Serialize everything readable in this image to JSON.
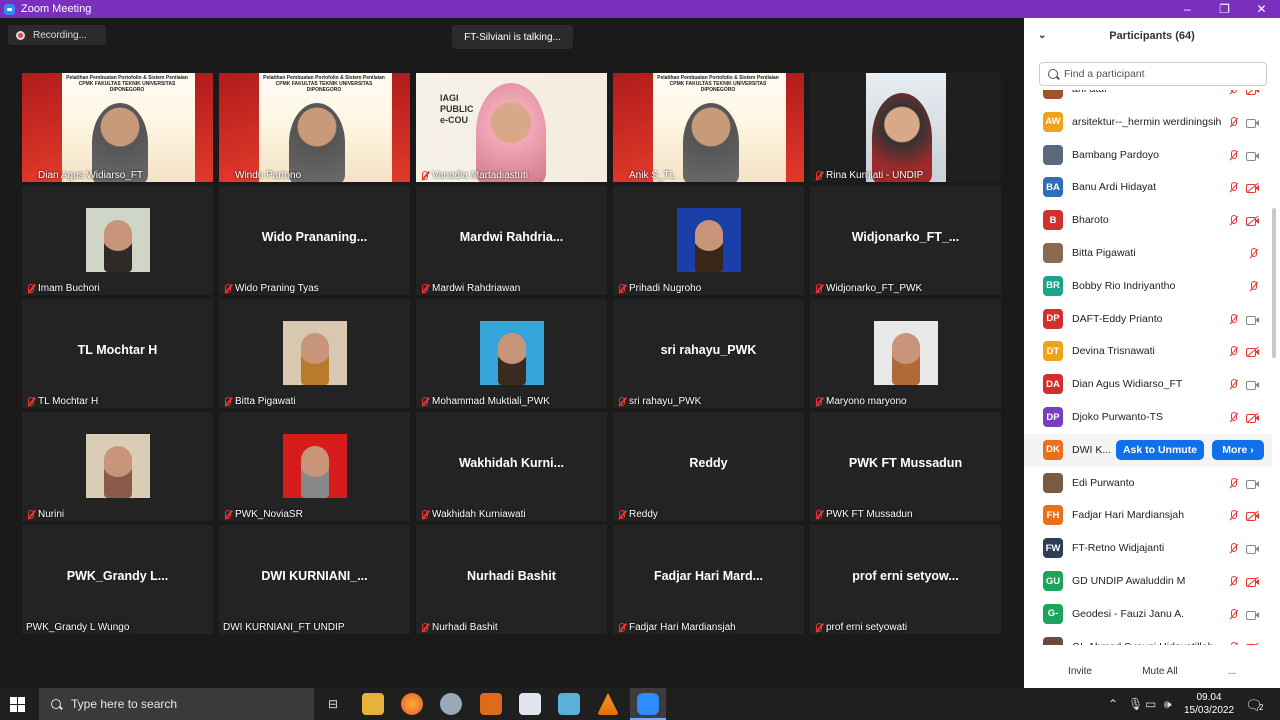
{
  "window": {
    "title": "Zoom Meeting",
    "minimize": "–",
    "maximize": "❐",
    "close": "✕"
  },
  "meeting": {
    "recording_label": "Recording...",
    "talking_label": "FT-Silviani is talking..."
  },
  "tiles": [
    {
      "name": "Dian Agus Widiarso_FT",
      "kind": "video-banner",
      "center": ""
    },
    {
      "name": "Windu Partono",
      "kind": "video-banner",
      "center": ""
    },
    {
      "name": "Vanadia Martadiastuti",
      "kind": "video-public",
      "center": ""
    },
    {
      "name": "Anik S_TL",
      "kind": "video-banner",
      "center": ""
    },
    {
      "name": "Rina Kurniati - UNDIP",
      "kind": "video-room",
      "center": ""
    },
    {
      "name": "Imam Buchori",
      "kind": "photo",
      "center": ""
    },
    {
      "name": "Wido Praning Tyas",
      "kind": "text",
      "center": "Wido Prananing..."
    },
    {
      "name": "Mardwi Rahdriawan",
      "kind": "text",
      "center": "Mardwi Rahdria..."
    },
    {
      "name": "Prihadi Nugroho",
      "kind": "photo",
      "center": ""
    },
    {
      "name": "Widjonarko_FT_PWK",
      "kind": "text",
      "center": "Widjonarko_FT_..."
    },
    {
      "name": "TL Mochtar H",
      "kind": "text",
      "center": "TL Mochtar H"
    },
    {
      "name": "Bitta Pigawati",
      "kind": "photo",
      "center": ""
    },
    {
      "name": "Mohammad Muktiali_PWK",
      "kind": "photo",
      "center": ""
    },
    {
      "name": "sri rahayu_PWK",
      "kind": "text",
      "center": "sri rahayu_PWK"
    },
    {
      "name": "Maryono maryono",
      "kind": "photo",
      "center": ""
    },
    {
      "name": "Nurini",
      "kind": "photo",
      "center": ""
    },
    {
      "name": "PWK_NoviaSR",
      "kind": "photo",
      "center": ""
    },
    {
      "name": "Wakhidah Kurniawati",
      "kind": "text",
      "center": "Wakhidah Kurni..."
    },
    {
      "name": "Reddy",
      "kind": "text",
      "center": "Reddy"
    },
    {
      "name": "PWK FT Mussadun",
      "kind": "text",
      "center": "PWK FT Mussadun"
    },
    {
      "name": "PWK_Grandy L Wungo",
      "kind": "text",
      "center": "PWK_Grandy L..."
    },
    {
      "name": "DWI KURNIANI_FT UNDIP",
      "kind": "text",
      "center": "DWI KURNIANI_..."
    },
    {
      "name": "Nurhadi Bashit",
      "kind": "text",
      "center": "Nurhadi Bashit"
    },
    {
      "name": "Fadjar Hari Mardiansjah",
      "kind": "text",
      "center": "Fadjar Hari Mard..."
    },
    {
      "name": "prof erni setyowati",
      "kind": "text",
      "center": "prof erni setyow..."
    }
  ],
  "banner_text": "Pelatihan Pembuatan Portofolio & Sistem Penilaian CPMK FAKULTAS TEKNIK UNIVERSITAS DIPONEGORO",
  "public_text": "IAGI PUBLIC e-COU",
  "panel": {
    "title": "Participants (64)",
    "search_placeholder": "Find a participant",
    "ask_to_unmute": "Ask to Unmute",
    "more": "More ›",
    "invite": "Invite",
    "mute_all": "Mute All",
    "ellipsis": "..."
  },
  "participants": [
    {
      "initials": "",
      "name": "arif atur",
      "color": "#a0522d",
      "cam": "off",
      "partial": true
    },
    {
      "initials": "AW",
      "name": "arsitektur--_hermin werdiningsih",
      "color": "#f2a11b",
      "cam": "on"
    },
    {
      "initials": "",
      "name": "Bambang Pardoyo",
      "color": "#5a6a7a",
      "cam": "on"
    },
    {
      "initials": "BA",
      "name": "Banu Ardi Hidayat",
      "color": "#2f6db5",
      "cam": "off"
    },
    {
      "initials": "B",
      "name": "Bharoto",
      "color": "#d0312d",
      "cam": "off"
    },
    {
      "initials": "",
      "name": "Bitta Pigawati",
      "color": "#8a6a50",
      "cam": "none"
    },
    {
      "initials": "BR",
      "name": "Bobby Rio Indriyantho",
      "color": "#1aa58a",
      "cam": "none"
    },
    {
      "initials": "DP",
      "name": "DAFT-Eddy Prianto",
      "color": "#d0312d",
      "cam": "on"
    },
    {
      "initials": "DT",
      "name": "Devina Trisnawati",
      "color": "#f2a11b",
      "cam": "off"
    },
    {
      "initials": "DA",
      "name": "Dian Agus Widiarso_FT",
      "color": "#d0312d",
      "cam": "on"
    },
    {
      "initials": "DP",
      "name": "Djoko Purwanto-TS",
      "color": "#7a3fbf",
      "cam": "off"
    },
    {
      "initials": "DK",
      "name": "DWI K...",
      "color": "#e8701a",
      "cam": "hover"
    },
    {
      "initials": "",
      "name": "Edi Purwanto",
      "color": "#7a5a40",
      "cam": "on"
    },
    {
      "initials": "FH",
      "name": "Fadjar Hari Mardiansjah",
      "color": "#e8701a",
      "cam": "off"
    },
    {
      "initials": "FW",
      "name": "FT-Retno Widjajanti",
      "color": "#2d3e55",
      "cam": "on"
    },
    {
      "initials": "GU",
      "name": "GD UNDIP Awaluddin M",
      "color": "#1aa55a",
      "cam": "off"
    },
    {
      "initials": "G-",
      "name": "Geodesi - Fauzi Janu A.",
      "color": "#1aa55a",
      "cam": "on"
    },
    {
      "initials": "",
      "name": "GL Ahmad Syauqi Hidayatillah",
      "color": "#6a4a3a",
      "cam": "off",
      "partial": true
    }
  ],
  "taskbar": {
    "search_placeholder": "Type here to search",
    "time": "09.04",
    "date": "15/03/2022",
    "notification_count": "2"
  }
}
